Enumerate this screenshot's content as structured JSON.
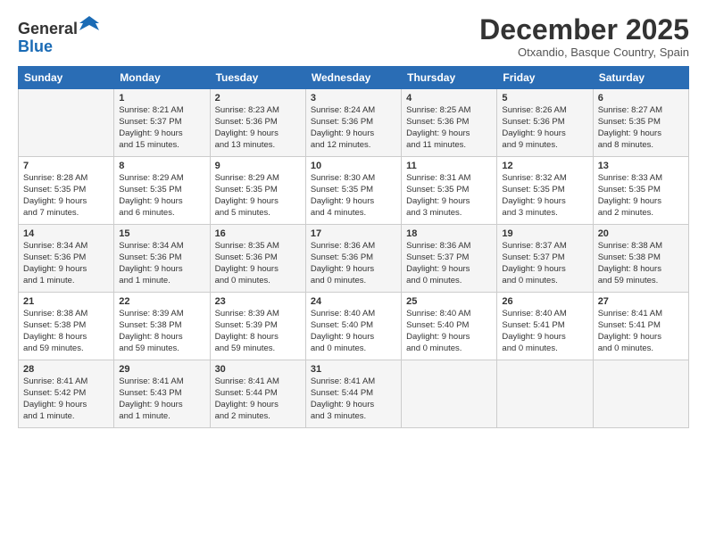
{
  "header": {
    "logo_general": "General",
    "logo_blue": "Blue",
    "title": "December 2025",
    "subtitle": "Otxandio, Basque Country, Spain"
  },
  "days_of_week": [
    "Sunday",
    "Monday",
    "Tuesday",
    "Wednesday",
    "Thursday",
    "Friday",
    "Saturday"
  ],
  "weeks": [
    [
      {
        "day": "",
        "lines": []
      },
      {
        "day": "1",
        "lines": [
          "Sunrise: 8:21 AM",
          "Sunset: 5:37 PM",
          "Daylight: 9 hours",
          "and 15 minutes."
        ]
      },
      {
        "day": "2",
        "lines": [
          "Sunrise: 8:23 AM",
          "Sunset: 5:36 PM",
          "Daylight: 9 hours",
          "and 13 minutes."
        ]
      },
      {
        "day": "3",
        "lines": [
          "Sunrise: 8:24 AM",
          "Sunset: 5:36 PM",
          "Daylight: 9 hours",
          "and 12 minutes."
        ]
      },
      {
        "day": "4",
        "lines": [
          "Sunrise: 8:25 AM",
          "Sunset: 5:36 PM",
          "Daylight: 9 hours",
          "and 11 minutes."
        ]
      },
      {
        "day": "5",
        "lines": [
          "Sunrise: 8:26 AM",
          "Sunset: 5:36 PM",
          "Daylight: 9 hours",
          "and 9 minutes."
        ]
      },
      {
        "day": "6",
        "lines": [
          "Sunrise: 8:27 AM",
          "Sunset: 5:35 PM",
          "Daylight: 9 hours",
          "and 8 minutes."
        ]
      }
    ],
    [
      {
        "day": "7",
        "lines": [
          "Sunrise: 8:28 AM",
          "Sunset: 5:35 PM",
          "Daylight: 9 hours",
          "and 7 minutes."
        ]
      },
      {
        "day": "8",
        "lines": [
          "Sunrise: 8:29 AM",
          "Sunset: 5:35 PM",
          "Daylight: 9 hours",
          "and 6 minutes."
        ]
      },
      {
        "day": "9",
        "lines": [
          "Sunrise: 8:29 AM",
          "Sunset: 5:35 PM",
          "Daylight: 9 hours",
          "and 5 minutes."
        ]
      },
      {
        "day": "10",
        "lines": [
          "Sunrise: 8:30 AM",
          "Sunset: 5:35 PM",
          "Daylight: 9 hours",
          "and 4 minutes."
        ]
      },
      {
        "day": "11",
        "lines": [
          "Sunrise: 8:31 AM",
          "Sunset: 5:35 PM",
          "Daylight: 9 hours",
          "and 3 minutes."
        ]
      },
      {
        "day": "12",
        "lines": [
          "Sunrise: 8:32 AM",
          "Sunset: 5:35 PM",
          "Daylight: 9 hours",
          "and 3 minutes."
        ]
      },
      {
        "day": "13",
        "lines": [
          "Sunrise: 8:33 AM",
          "Sunset: 5:35 PM",
          "Daylight: 9 hours",
          "and 2 minutes."
        ]
      }
    ],
    [
      {
        "day": "14",
        "lines": [
          "Sunrise: 8:34 AM",
          "Sunset: 5:36 PM",
          "Daylight: 9 hours",
          "and 1 minute."
        ]
      },
      {
        "day": "15",
        "lines": [
          "Sunrise: 8:34 AM",
          "Sunset: 5:36 PM",
          "Daylight: 9 hours",
          "and 1 minute."
        ]
      },
      {
        "day": "16",
        "lines": [
          "Sunrise: 8:35 AM",
          "Sunset: 5:36 PM",
          "Daylight: 9 hours",
          "and 0 minutes."
        ]
      },
      {
        "day": "17",
        "lines": [
          "Sunrise: 8:36 AM",
          "Sunset: 5:36 PM",
          "Daylight: 9 hours",
          "and 0 minutes."
        ]
      },
      {
        "day": "18",
        "lines": [
          "Sunrise: 8:36 AM",
          "Sunset: 5:37 PM",
          "Daylight: 9 hours",
          "and 0 minutes."
        ]
      },
      {
        "day": "19",
        "lines": [
          "Sunrise: 8:37 AM",
          "Sunset: 5:37 PM",
          "Daylight: 9 hours",
          "and 0 minutes."
        ]
      },
      {
        "day": "20",
        "lines": [
          "Sunrise: 8:38 AM",
          "Sunset: 5:38 PM",
          "Daylight: 8 hours",
          "and 59 minutes."
        ]
      }
    ],
    [
      {
        "day": "21",
        "lines": [
          "Sunrise: 8:38 AM",
          "Sunset: 5:38 PM",
          "Daylight: 8 hours",
          "and 59 minutes."
        ]
      },
      {
        "day": "22",
        "lines": [
          "Sunrise: 8:39 AM",
          "Sunset: 5:38 PM",
          "Daylight: 8 hours",
          "and 59 minutes."
        ]
      },
      {
        "day": "23",
        "lines": [
          "Sunrise: 8:39 AM",
          "Sunset: 5:39 PM",
          "Daylight: 8 hours",
          "and 59 minutes."
        ]
      },
      {
        "day": "24",
        "lines": [
          "Sunrise: 8:40 AM",
          "Sunset: 5:40 PM",
          "Daylight: 9 hours",
          "and 0 minutes."
        ]
      },
      {
        "day": "25",
        "lines": [
          "Sunrise: 8:40 AM",
          "Sunset: 5:40 PM",
          "Daylight: 9 hours",
          "and 0 minutes."
        ]
      },
      {
        "day": "26",
        "lines": [
          "Sunrise: 8:40 AM",
          "Sunset: 5:41 PM",
          "Daylight: 9 hours",
          "and 0 minutes."
        ]
      },
      {
        "day": "27",
        "lines": [
          "Sunrise: 8:41 AM",
          "Sunset: 5:41 PM",
          "Daylight: 9 hours",
          "and 0 minutes."
        ]
      }
    ],
    [
      {
        "day": "28",
        "lines": [
          "Sunrise: 8:41 AM",
          "Sunset: 5:42 PM",
          "Daylight: 9 hours",
          "and 1 minute."
        ]
      },
      {
        "day": "29",
        "lines": [
          "Sunrise: 8:41 AM",
          "Sunset: 5:43 PM",
          "Daylight: 9 hours",
          "and 1 minute."
        ]
      },
      {
        "day": "30",
        "lines": [
          "Sunrise: 8:41 AM",
          "Sunset: 5:44 PM",
          "Daylight: 9 hours",
          "and 2 minutes."
        ]
      },
      {
        "day": "31",
        "lines": [
          "Sunrise: 8:41 AM",
          "Sunset: 5:44 PM",
          "Daylight: 9 hours",
          "and 3 minutes."
        ]
      },
      {
        "day": "",
        "lines": []
      },
      {
        "day": "",
        "lines": []
      },
      {
        "day": "",
        "lines": []
      }
    ]
  ]
}
